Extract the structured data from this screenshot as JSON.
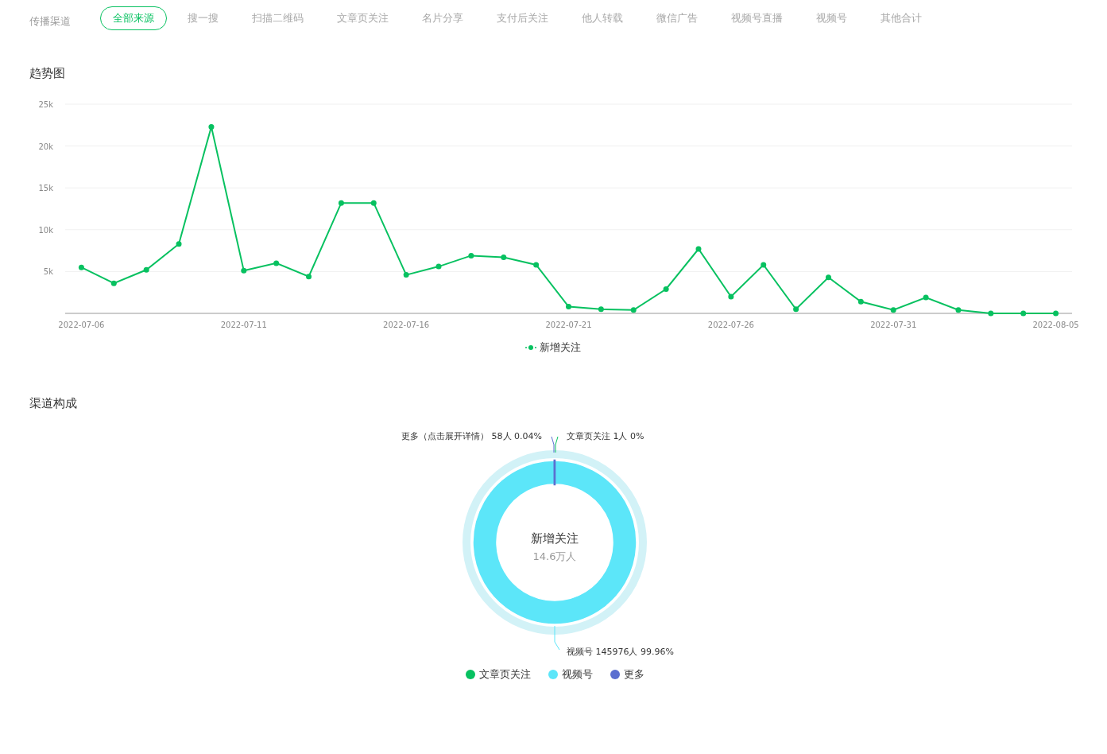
{
  "filter": {
    "label": "传播渠道",
    "tabs": [
      {
        "label": "全部来源",
        "selected": true
      },
      {
        "label": "搜一搜",
        "selected": false
      },
      {
        "label": "扫描二维码",
        "selected": false
      },
      {
        "label": "文章页关注",
        "selected": false
      },
      {
        "label": "名片分享",
        "selected": false
      },
      {
        "label": "支付后关注",
        "selected": false
      },
      {
        "label": "他人转载",
        "selected": false
      },
      {
        "label": "微信广告",
        "selected": false
      },
      {
        "label": "视频号直播",
        "selected": false
      },
      {
        "label": "视频号",
        "selected": false
      },
      {
        "label": "其他合计",
        "selected": false
      }
    ]
  },
  "trend": {
    "title": "趋势图",
    "chart_data": {
      "type": "line",
      "categories": [
        "2022-07-06",
        null,
        null,
        null,
        null,
        "2022-07-11",
        null,
        null,
        null,
        null,
        "2022-07-16",
        null,
        null,
        null,
        null,
        "2022-07-21",
        null,
        null,
        null,
        null,
        "2022-07-26",
        null,
        null,
        null,
        null,
        "2022-07-31",
        null,
        null,
        null,
        null,
        "2022-08-05"
      ],
      "grid": true,
      "series": [
        {
          "name": "新增关注",
          "color": "#07c160",
          "marker": "circle",
          "values": [
            5500,
            3600,
            5200,
            8300,
            22300,
            5100,
            6000,
            4400,
            13200,
            13200,
            4600,
            5600,
            6900,
            6700,
            5800,
            800,
            500,
            400,
            2900,
            7700,
            2000,
            5800,
            500,
            4300,
            1400,
            400,
            1900,
            400,
            0,
            0,
            0
          ]
        }
      ],
      "ylim": [
        0,
        25000
      ],
      "yticks": [
        {
          "value": 5000,
          "label": "5k"
        },
        {
          "value": 10000,
          "label": "10k"
        },
        {
          "value": 15000,
          "label": "15k"
        },
        {
          "value": 20000,
          "label": "20k"
        },
        {
          "value": 25000,
          "label": "25k"
        }
      ],
      "legend": "bottom"
    }
  },
  "composition": {
    "title": "渠道构成",
    "center_value": "14.6万人",
    "chart_data": {
      "type": "donut",
      "categories": [
        "文章页关注",
        "视频号",
        "更多"
      ],
      "series": [
        {
          "name": "新增关注",
          "values": [
            0,
            99.96,
            0.04
          ]
        }
      ],
      "value_labels": [
        "文章页关注 1人 0%",
        "视频号 145976人 99.96%",
        "更多（点击展开详情） 58人 0.04%"
      ],
      "legend": "bottom"
    },
    "legend": [
      {
        "color": "#07c160"
      },
      {
        "color": "#5ce6f9"
      },
      {
        "color": "#5b6fd0"
      }
    ]
  }
}
